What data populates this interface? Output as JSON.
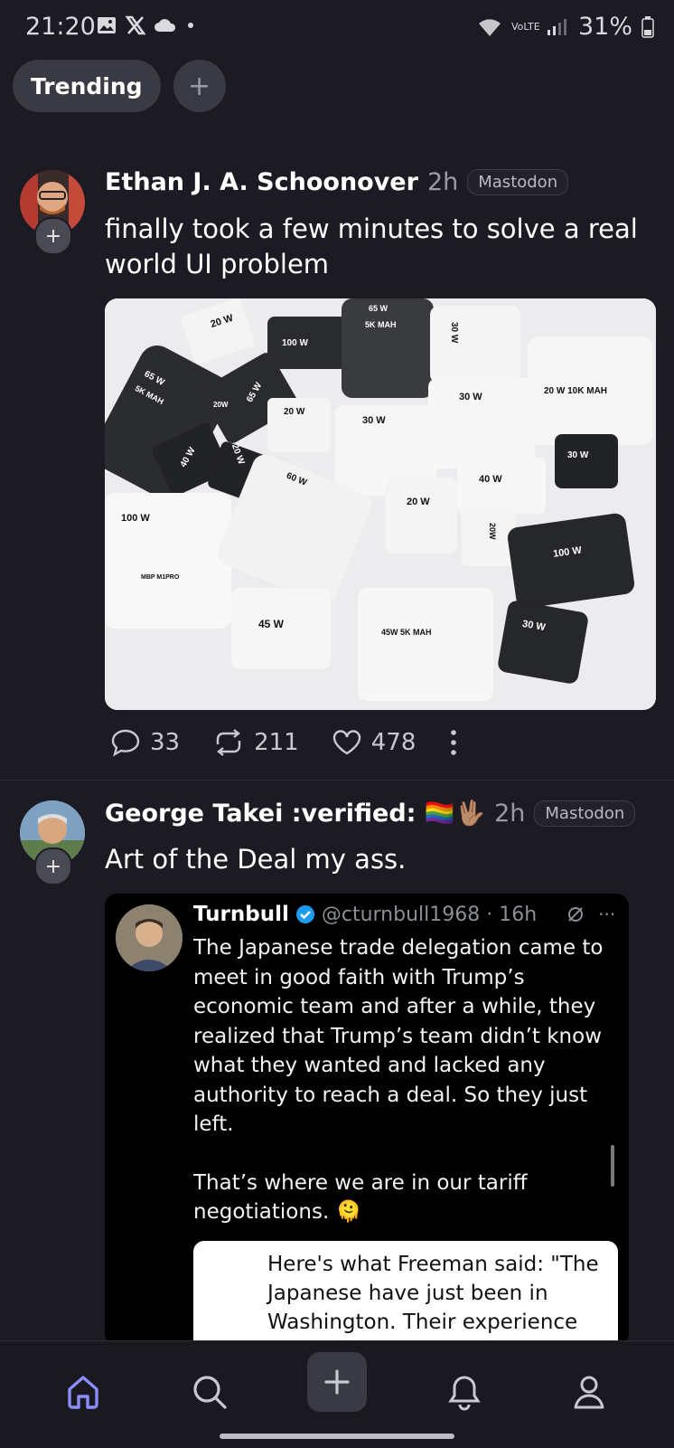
{
  "status_bar": {
    "time": "21:20",
    "battery": "31%",
    "network_label": "VoLTE",
    "icons": [
      "gallery-icon",
      "x-logo-icon",
      "cloud-icon",
      "dot-icon",
      "wifi-icon",
      "signal-icon",
      "battery-icon"
    ]
  },
  "tabs": {
    "active_label": "Trending",
    "add_label": "+"
  },
  "posts": [
    {
      "author": "Ethan J. A. Schoonover",
      "time": "2h",
      "platform": "Mastodon",
      "text": "finally took a few minutes to solve a real world UI problem",
      "media": {
        "labels": [
          "20 W",
          "100 W",
          "65 W",
          "5K MAH",
          "30 W",
          "65 W",
          "5K MAH",
          "20W",
          "65 W",
          "20 W",
          "30 W",
          "30 W",
          "20 W 10K MAH",
          "40 W",
          "20 W",
          "30 W",
          "60 W",
          "40 W",
          "100 W",
          "20 W",
          "20W",
          "100 W",
          "MBP M1PRO",
          "45 W",
          "45W 5K MAH",
          "30 W"
        ]
      },
      "replies": "33",
      "boosts": "211",
      "favourites": "478"
    },
    {
      "author": "George Takei :verified: 🏳️‍🌈🖖🏽",
      "time": "2h",
      "platform": "Mastodon",
      "text": "Art of the Deal my ass.",
      "embedded_tweet": {
        "name": "Turnbull",
        "handle": "@cturnbull1968 · 16h",
        "body_1": "The Japanese trade delegation came to meet in good faith with Trump’s economic team and after a while, they realized that Trump’s team didn’t know what they wanted and lacked any authority to reach a deal. So they just left.",
        "body_2": "That’s where we are in our tariff negotiations. 🫠",
        "quote": "Here's what Freeman said: \"The Japanese have just been in Washington. Their experience"
      }
    }
  ],
  "bottom_nav": {
    "items": [
      "home-icon",
      "search-icon",
      "compose-icon",
      "notifications-icon",
      "profile-icon"
    ],
    "active": "home",
    "accent": "#8a8cff"
  }
}
